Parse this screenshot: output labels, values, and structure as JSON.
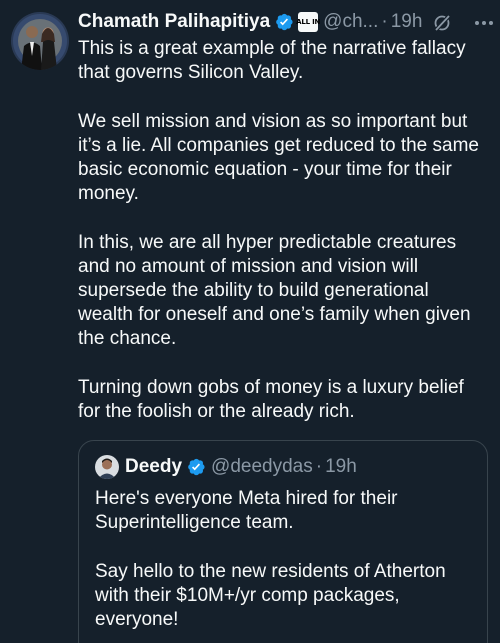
{
  "tweet": {
    "author_name": "Chamath Palihapitiya",
    "affiliate_badge": "ALL IN",
    "handle": "@ch...",
    "separator": "·",
    "time": "19h",
    "paragraphs": [
      "This is a great example of the narrative fallacy that governs Silicon Valley.",
      "We sell mission and vision as so important but it’s a lie. All companies get reduced to the same basic economic equation - your time for their money.",
      "In this, we are all hyper predictable creatures and no amount of mission and vision will supersede the ability to build generational wealth for oneself and one’s family when given the chance.",
      "Turning down gobs of money is a luxury belief for the foolish or the already rich."
    ]
  },
  "quoted_tweet": {
    "author_name": "Deedy",
    "handle": "@deedydas",
    "separator": "·",
    "time": "19h",
    "paragraphs": [
      "Here's everyone Meta hired for their Superintelligence team.",
      "Say hello to the new residents of Atherton with their $10M+/yr comp packages, everyone!"
    ]
  },
  "icons": {
    "verified": "verified-badge-icon",
    "grok": "grok-icon",
    "more": "more-options-icon"
  },
  "colors": {
    "background": "#15202b",
    "text": "#f7f9f9",
    "secondary": "#8b98a5",
    "verified": "#1d9bf0",
    "border": "#38444d"
  }
}
